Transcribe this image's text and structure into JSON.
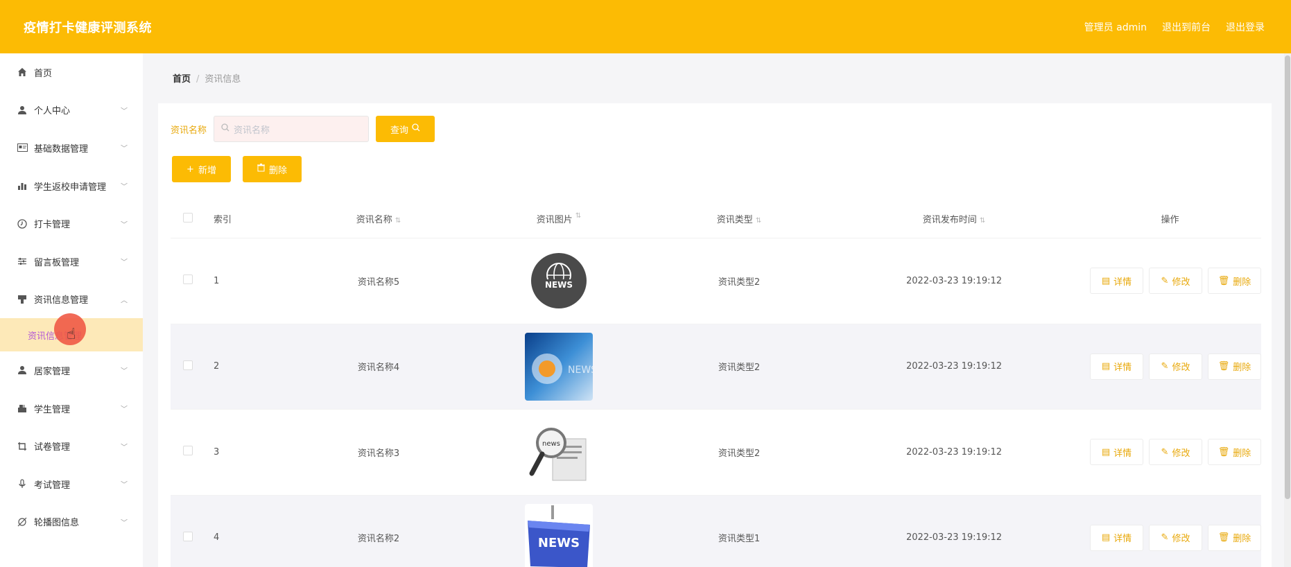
{
  "header": {
    "title": "疫情打卡健康评测系统",
    "links": [
      "管理员 admin",
      "退出到前台",
      "退出登录"
    ]
  },
  "sidebar": {
    "items": [
      {
        "label": "首页",
        "icon": "home-icon",
        "chevron": false
      },
      {
        "label": "个人中心",
        "icon": "user-icon",
        "chevron": true
      },
      {
        "label": "基础数据管理",
        "icon": "id-card-icon",
        "chevron": true
      },
      {
        "label": "学生返校申请管理",
        "icon": "bar-chart-icon",
        "chevron": true
      },
      {
        "label": "打卡管理",
        "icon": "clock-icon",
        "chevron": true
      },
      {
        "label": "留言板管理",
        "icon": "sliders-icon",
        "chevron": true
      },
      {
        "label": "资讯信息管理",
        "icon": "news-icon",
        "chevron": "up"
      }
    ],
    "submenu": {
      "label": "资讯信息管理"
    },
    "items_after": [
      {
        "label": "居家管理",
        "icon": "user-icon"
      },
      {
        "label": "学生管理",
        "icon": "mailbox-icon"
      },
      {
        "label": "试卷管理",
        "icon": "crop-icon"
      },
      {
        "label": "考试管理",
        "icon": "mic-icon"
      },
      {
        "label": "轮播图信息",
        "icon": "slash-icon"
      }
    ]
  },
  "breadcrumb": {
    "home": "首页",
    "current": "资讯信息"
  },
  "search": {
    "label": "资讯名称",
    "placeholder": "资讯名称",
    "button": "查询"
  },
  "actions": {
    "add": "新增",
    "delete": "删除"
  },
  "table": {
    "headers": [
      "索引",
      "资讯名称",
      "资讯图片",
      "资讯类型",
      "资讯发布时间",
      "操作"
    ],
    "rows": [
      {
        "index": "1",
        "name": "资讯名称5",
        "type": "资讯类型2",
        "time": "2022-03-23 19:19:12",
        "img": "globe-news"
      },
      {
        "index": "2",
        "name": "资讯名称4",
        "type": "资讯类型2",
        "time": "2022-03-23 19:19:12",
        "img": "blue-news"
      },
      {
        "index": "3",
        "name": "资讯名称3",
        "type": "资讯类型2",
        "time": "2022-03-23 19:19:12",
        "img": "magnifier-news"
      },
      {
        "index": "4",
        "name": "资讯名称2",
        "type": "资讯类型1",
        "time": "2022-03-23 19:19:12",
        "img": "key-news"
      }
    ],
    "row_actions": {
      "detail": "详情",
      "edit": "修改",
      "delete": "删除"
    }
  },
  "colors": {
    "accent": "#fcbb04",
    "link": "#e8a80a",
    "submenu_bg": "#fde9b8",
    "submenu_text": "#b45ad6"
  }
}
